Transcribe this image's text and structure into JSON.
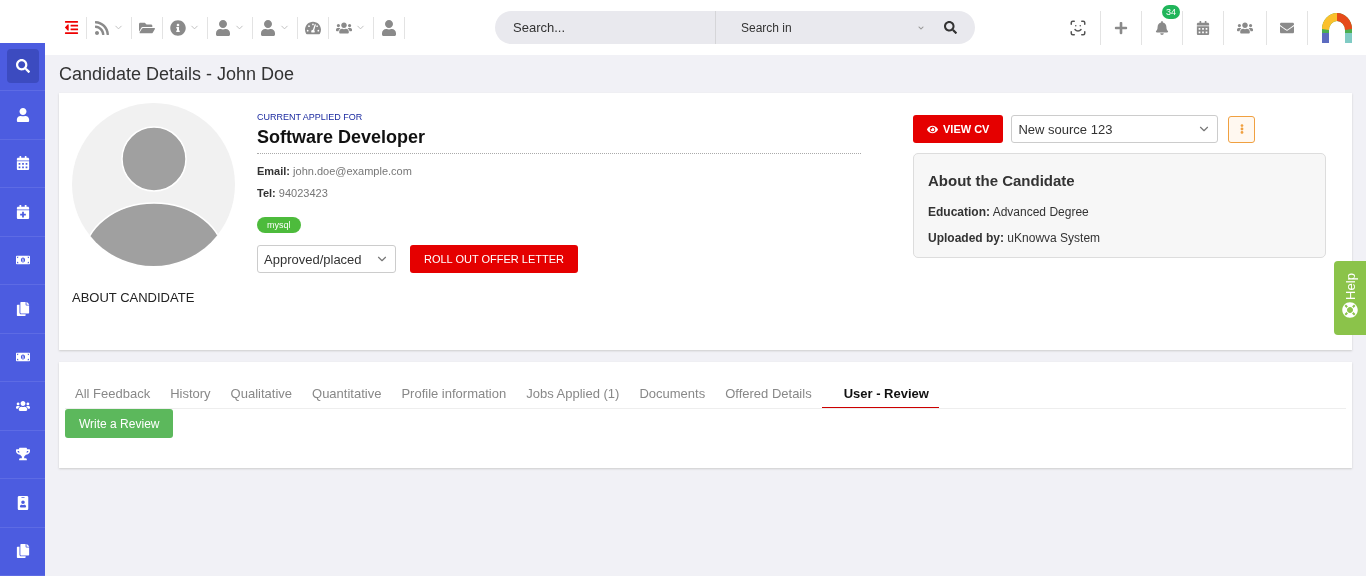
{
  "topbar": {
    "search": {
      "placeholder": "Search...",
      "scope": "Search in"
    },
    "notifications": "34"
  },
  "sidebar": {
    "items": [
      {
        "selected": true
      },
      {
        "selected": false
      },
      {
        "selected": false
      },
      {
        "selected": false
      },
      {
        "selected": false
      },
      {
        "selected": false
      },
      {
        "selected": false
      },
      {
        "selected": false
      },
      {
        "selected": false
      },
      {
        "selected": false
      },
      {
        "selected": false
      }
    ]
  },
  "page_title": "Candidate Details - John Doe",
  "candidate": {
    "applied_label": "CURRENT APPLIED FOR",
    "position": "Software Developer",
    "email_label": "Email:",
    "email": "john.doe@example.com",
    "tel_label": "Tel:",
    "tel": "94023423",
    "tags": [
      "mysql"
    ],
    "status": "Approved/placed",
    "offer_button": "ROLL OUT OFFER LETTER",
    "about_heading": "ABOUT CANDIDATE"
  },
  "actions": {
    "view_cv": "VIEW CV",
    "source": "New source 123"
  },
  "about": {
    "title": "About the Candidate",
    "fields": [
      {
        "label": "Education:",
        "value": "Advanced Degree"
      },
      {
        "label": "Uploaded by:",
        "value": "uKnowva System"
      }
    ]
  },
  "tabs": [
    {
      "label": "All Feedback",
      "selected": false
    },
    {
      "label": "History",
      "selected": false
    },
    {
      "label": "Qualitative",
      "selected": false
    },
    {
      "label": "Quantitative",
      "selected": false
    },
    {
      "label": "Profile information",
      "selected": false
    },
    {
      "label": "Jobs Applied (1)",
      "selected": false
    },
    {
      "label": "Documents",
      "selected": false
    },
    {
      "label": "Offered Details",
      "selected": false
    },
    {
      "label": "User - Review",
      "selected": true
    }
  ],
  "review_button": "Write a Review",
  "help": "Help"
}
